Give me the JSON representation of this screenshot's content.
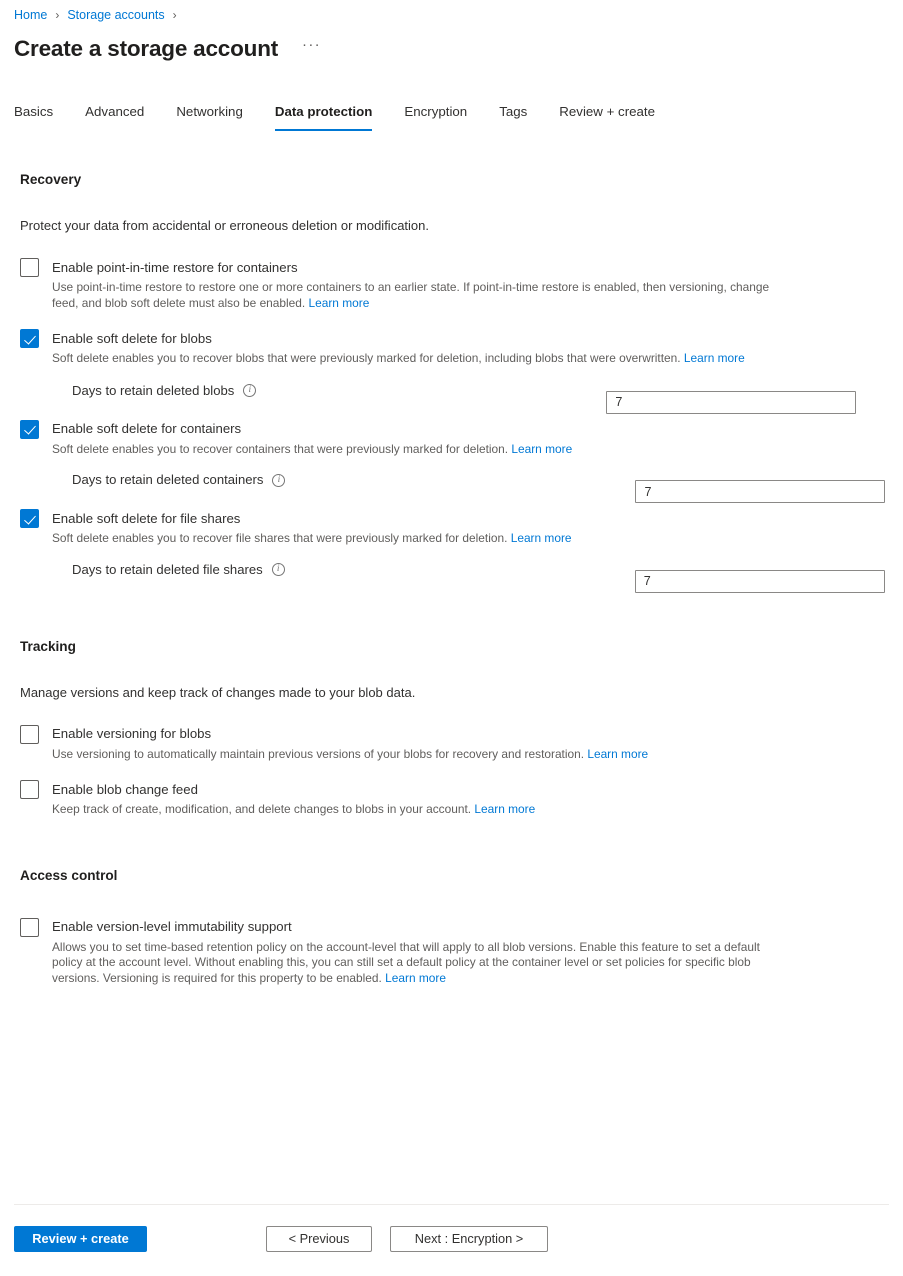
{
  "breadcrumb": {
    "items": [
      {
        "label": "Home"
      },
      {
        "label": "Storage accounts"
      }
    ],
    "separator": "›"
  },
  "header": {
    "title": "Create a storage account",
    "more_actions": "···"
  },
  "tabs": [
    {
      "label": "Basics",
      "active": false
    },
    {
      "label": "Advanced",
      "active": false
    },
    {
      "label": "Networking",
      "active": false
    },
    {
      "label": "Data protection",
      "active": true
    },
    {
      "label": "Encryption",
      "active": false
    },
    {
      "label": "Tags",
      "active": false
    },
    {
      "label": "Review + create",
      "active": false
    }
  ],
  "sections": {
    "recovery": {
      "heading": "Recovery",
      "description": "Protect your data from accidental or erroneous deletion or modification.",
      "point_in_time": {
        "label": "Enable point-in-time restore for containers",
        "checked": false,
        "description": "Use point-in-time restore to restore one or more containers to an earlier state. If point-in-time restore is enabled, then versioning, change feed, and blob soft delete must also be enabled.",
        "learn_more": "Learn more"
      },
      "soft_delete_blobs": {
        "label": "Enable soft delete for blobs",
        "checked": true,
        "description": "Soft delete enables you to recover blobs that were previously marked for deletion, including blobs that were overwritten.",
        "learn_more": "Learn more",
        "field_label": "Days to retain deleted blobs",
        "field_value": "7",
        "info_tooltip": "info-icon"
      },
      "soft_delete_containers": {
        "label": "Enable soft delete for containers",
        "checked": true,
        "description": "Soft delete enables you to recover containers that were previously marked for deletion.",
        "learn_more": "Learn more",
        "field_label": "Days to retain deleted containers",
        "field_value": "7",
        "info_tooltip": "info-icon"
      },
      "soft_delete_file_shares": {
        "label": "Enable soft delete for file shares",
        "checked": true,
        "description": "Soft delete enables you to recover file shares that were previously marked for deletion.",
        "learn_more": "Learn more",
        "field_label": "Days to retain deleted file shares",
        "field_value": "7",
        "info_tooltip": "info-icon"
      }
    },
    "tracking": {
      "heading": "Tracking",
      "description": "Manage versions and keep track of changes made to your blob data.",
      "versioning": {
        "label": "Enable versioning for blobs",
        "checked": false,
        "description": "Use versioning to automatically maintain previous versions of your blobs for recovery and restoration.",
        "learn_more": "Learn more"
      },
      "change_feed": {
        "label": "Enable blob change feed",
        "checked": false,
        "description": "Keep track of create, modification, and delete changes to blobs in your account.",
        "learn_more": "Learn more"
      }
    },
    "access_control": {
      "heading": "Access control",
      "immutability": {
        "label": "Enable version-level immutability support",
        "checked": false,
        "description": "Allows you to set time-based retention policy on the account-level that will apply to all blob versions. Enable this feature to set a default policy at the account level. Without enabling this, you can still set a default policy at the container level or set policies for specific blob versions. Versioning is required for this property to be enabled.",
        "learn_more": "Learn more"
      }
    }
  },
  "footer": {
    "review_create": "Review + create",
    "previous": "< Previous",
    "next": "Next : Encryption >"
  },
  "colors": {
    "accent": "#0078d4",
    "link": "#0078d4",
    "text_primary": "#323130",
    "text_secondary": "#605e5c",
    "border": "#8a8886"
  }
}
